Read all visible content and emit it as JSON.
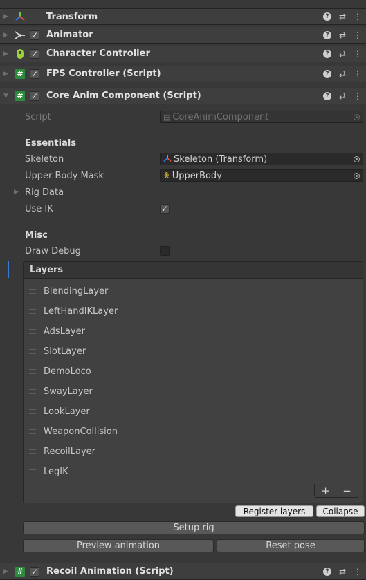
{
  "components": [
    {
      "title": "Transform",
      "icon": "transform-icon",
      "checkbox": false
    },
    {
      "title": "Animator",
      "icon": "animator-icon",
      "checkbox": true
    },
    {
      "title": "Character Controller",
      "icon": "character-controller-icon",
      "checkbox": true
    },
    {
      "title": "FPS Controller (Script)",
      "icon": "script-icon",
      "checkbox": true
    },
    {
      "title": "Core Anim Component (Script)",
      "icon": "script-icon",
      "checkbox": true,
      "expanded": true
    }
  ],
  "core": {
    "script_label": "Script",
    "script_value": "CoreAnimComponent",
    "essentials_label": "Essentials",
    "skeleton_label": "Skeleton",
    "skeleton_value": "Skeleton (Transform)",
    "mask_label": "Upper Body Mask",
    "mask_value": "UpperBody",
    "rig_data_label": "Rig Data",
    "use_ik_label": "Use IK",
    "use_ik_checked": true,
    "misc_label": "Misc",
    "draw_debug_label": "Draw Debug",
    "draw_debug_checked": false,
    "layers_title": "Layers",
    "layers": [
      "BlendingLayer",
      "LeftHandIKLayer",
      "AdsLayer",
      "SlotLayer",
      "DemoLoco",
      "SwayLayer",
      "LookLayer",
      "WeaponCollision",
      "RecoilLayer",
      "LegIK"
    ],
    "add_glyph": "+",
    "remove_glyph": "−",
    "register_layers_label": "Register layers",
    "collapse_label": "Collapse",
    "setup_rig_label": "Setup rig",
    "preview_animation_label": "Preview animation",
    "reset_pose_label": "Reset pose"
  },
  "bottom_component": {
    "title": "Recoil Animation (Script)",
    "icon": "script-icon",
    "checkbox": true
  },
  "colors": {
    "script_icon": "#2e8b3e",
    "accent": "#3a7bd5"
  },
  "glyphs": {
    "check": "✓",
    "fold_closed": "▶",
    "fold_open": "▼",
    "hash": "#",
    "help": "?",
    "preset": "⇄",
    "menu": "⋮"
  }
}
